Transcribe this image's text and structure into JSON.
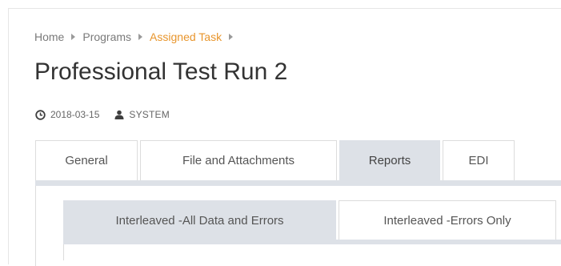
{
  "breadcrumb": {
    "items": [
      {
        "label": "Home"
      },
      {
        "label": "Programs"
      },
      {
        "label": "Assigned Task"
      }
    ]
  },
  "page": {
    "title": "Professional Test Run 2"
  },
  "meta": {
    "date": "2018-03-15",
    "user": "SYSTEM",
    "date_icon": "clock-icon",
    "user_icon": "user-icon"
  },
  "tabs": [
    {
      "label": "General",
      "active": false
    },
    {
      "label": "File and Attachments",
      "active": false
    },
    {
      "label": "Reports",
      "active": true
    },
    {
      "label": "EDI",
      "active": false
    }
  ],
  "report_tabs": [
    {
      "label": "Interleaved -All Data and Errors",
      "active": true
    },
    {
      "label": "Interleaved -Errors Only",
      "active": false
    }
  ],
  "colors": {
    "accent": "#e8952c",
    "active_tab_bg": "#dde1e7",
    "title_text": "#333333",
    "muted_text": "#7a7a7a"
  }
}
